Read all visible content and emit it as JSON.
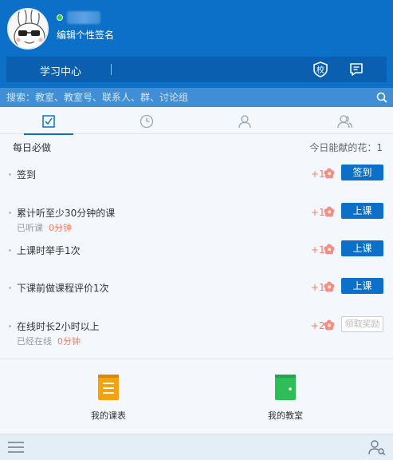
{
  "header": {
    "signature": "编辑个性签名",
    "nav_title": "学习中心",
    "icons": {
      "avatar": "rabbit-avatar",
      "school": "school-badge-icon",
      "message": "message-icon"
    }
  },
  "search": {
    "placeholder": "搜索：教室、教室号、联系人、群、讨论组"
  },
  "tabs": [
    "tasks-checkbox-icon",
    "clock-icon",
    "contact-icon",
    "group-icon"
  ],
  "tasks": {
    "title": "每日必做",
    "flowers_label": "今日能献的花：1",
    "items": [
      {
        "name": "签到",
        "sub_label": "",
        "sub_value": "",
        "sub_unit": "",
        "reward": "+1",
        "button": "签到",
        "enabled": true
      },
      {
        "name": "累计听至少30分钟的课",
        "sub_label": "已听课",
        "sub_value": "0",
        "sub_unit": "分钟",
        "reward": "+1",
        "button": "上课",
        "enabled": true
      },
      {
        "name": "上课时举手1次",
        "sub_label": "",
        "sub_value": "",
        "sub_unit": "",
        "reward": "+1",
        "button": "上课",
        "enabled": true
      },
      {
        "name": "下课前做课程评价1次",
        "sub_label": "",
        "sub_value": "",
        "sub_unit": "",
        "reward": "+1",
        "button": "上课",
        "enabled": true
      },
      {
        "name": "在线时长2小时以上",
        "sub_label": "已经在线",
        "sub_value": "0",
        "sub_unit": "分钟",
        "reward": "+2",
        "button": "领取奖励",
        "enabled": false
      }
    ]
  },
  "shortcuts": {
    "schedule": {
      "label": "我的课表",
      "icon": "schedule-book-icon"
    },
    "classroom": {
      "label": "我的教室",
      "icon": "classroom-door-icon"
    }
  },
  "footer": {
    "menu_icon": "menu-icon",
    "contacts_icon": "contacts-search-icon"
  },
  "colors": {
    "primary": "#0d70c8",
    "accent": "#ff7a59",
    "schedule": "#f5a20b",
    "classroom": "#2ebd59"
  }
}
